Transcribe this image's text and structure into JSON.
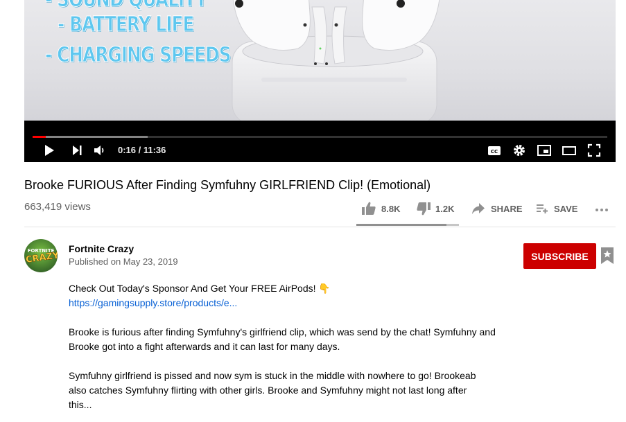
{
  "player": {
    "overlay_lines": [
      "- SOUND QUALITY",
      "- BATTERY LIFE",
      "- CHARGING SPEEDS"
    ],
    "time_display": "0:16 / 11:36",
    "progress_played_fraction": 0.0229,
    "progress_buffered_fraction": 0.2,
    "icons": [
      "play-icon",
      "next-icon",
      "volume-icon",
      "captions-icon",
      "settings-icon",
      "miniplayer-icon",
      "theater-icon",
      "fullscreen-icon"
    ]
  },
  "video": {
    "title": "Brooke FURIOUS After Finding Symfuhny GIRLFRIEND Clip! (Emotional)",
    "views": "663,419 views",
    "like_count": "8.8K",
    "dislike_count": "1.2K",
    "share_label": "SHARE",
    "save_label": "SAVE",
    "like_ratio": 0.88
  },
  "channel": {
    "name": "Fortnite Crazy",
    "published": "Published on May 23, 2019",
    "avatar_top": "FORTNITE",
    "avatar_bottom": "CRAZY",
    "subscribe_label": "SUBSCRIBE"
  },
  "description": {
    "line1": "Check Out Today's Sponsor And Get Your FREE AirPods! 👇",
    "link": "https://gamingsupply.store/products/e...",
    "para1": "Brooke is furious after finding Symfuhny's girlfriend clip, which was send by the chat! Symfuhny and Brooke got into a fight afterwards and it can last for many days.",
    "para2": "Symfuhny girlfriend is pissed and now sym is stuck in the middle with nowhere to go! Brookeab also catches Symfuhny flirting with other girls. Brooke and Symfuhny might not last long after this..."
  },
  "colors": {
    "subscribe": "#cc0000",
    "link": "#065fd4",
    "progress": "#ff0000"
  }
}
